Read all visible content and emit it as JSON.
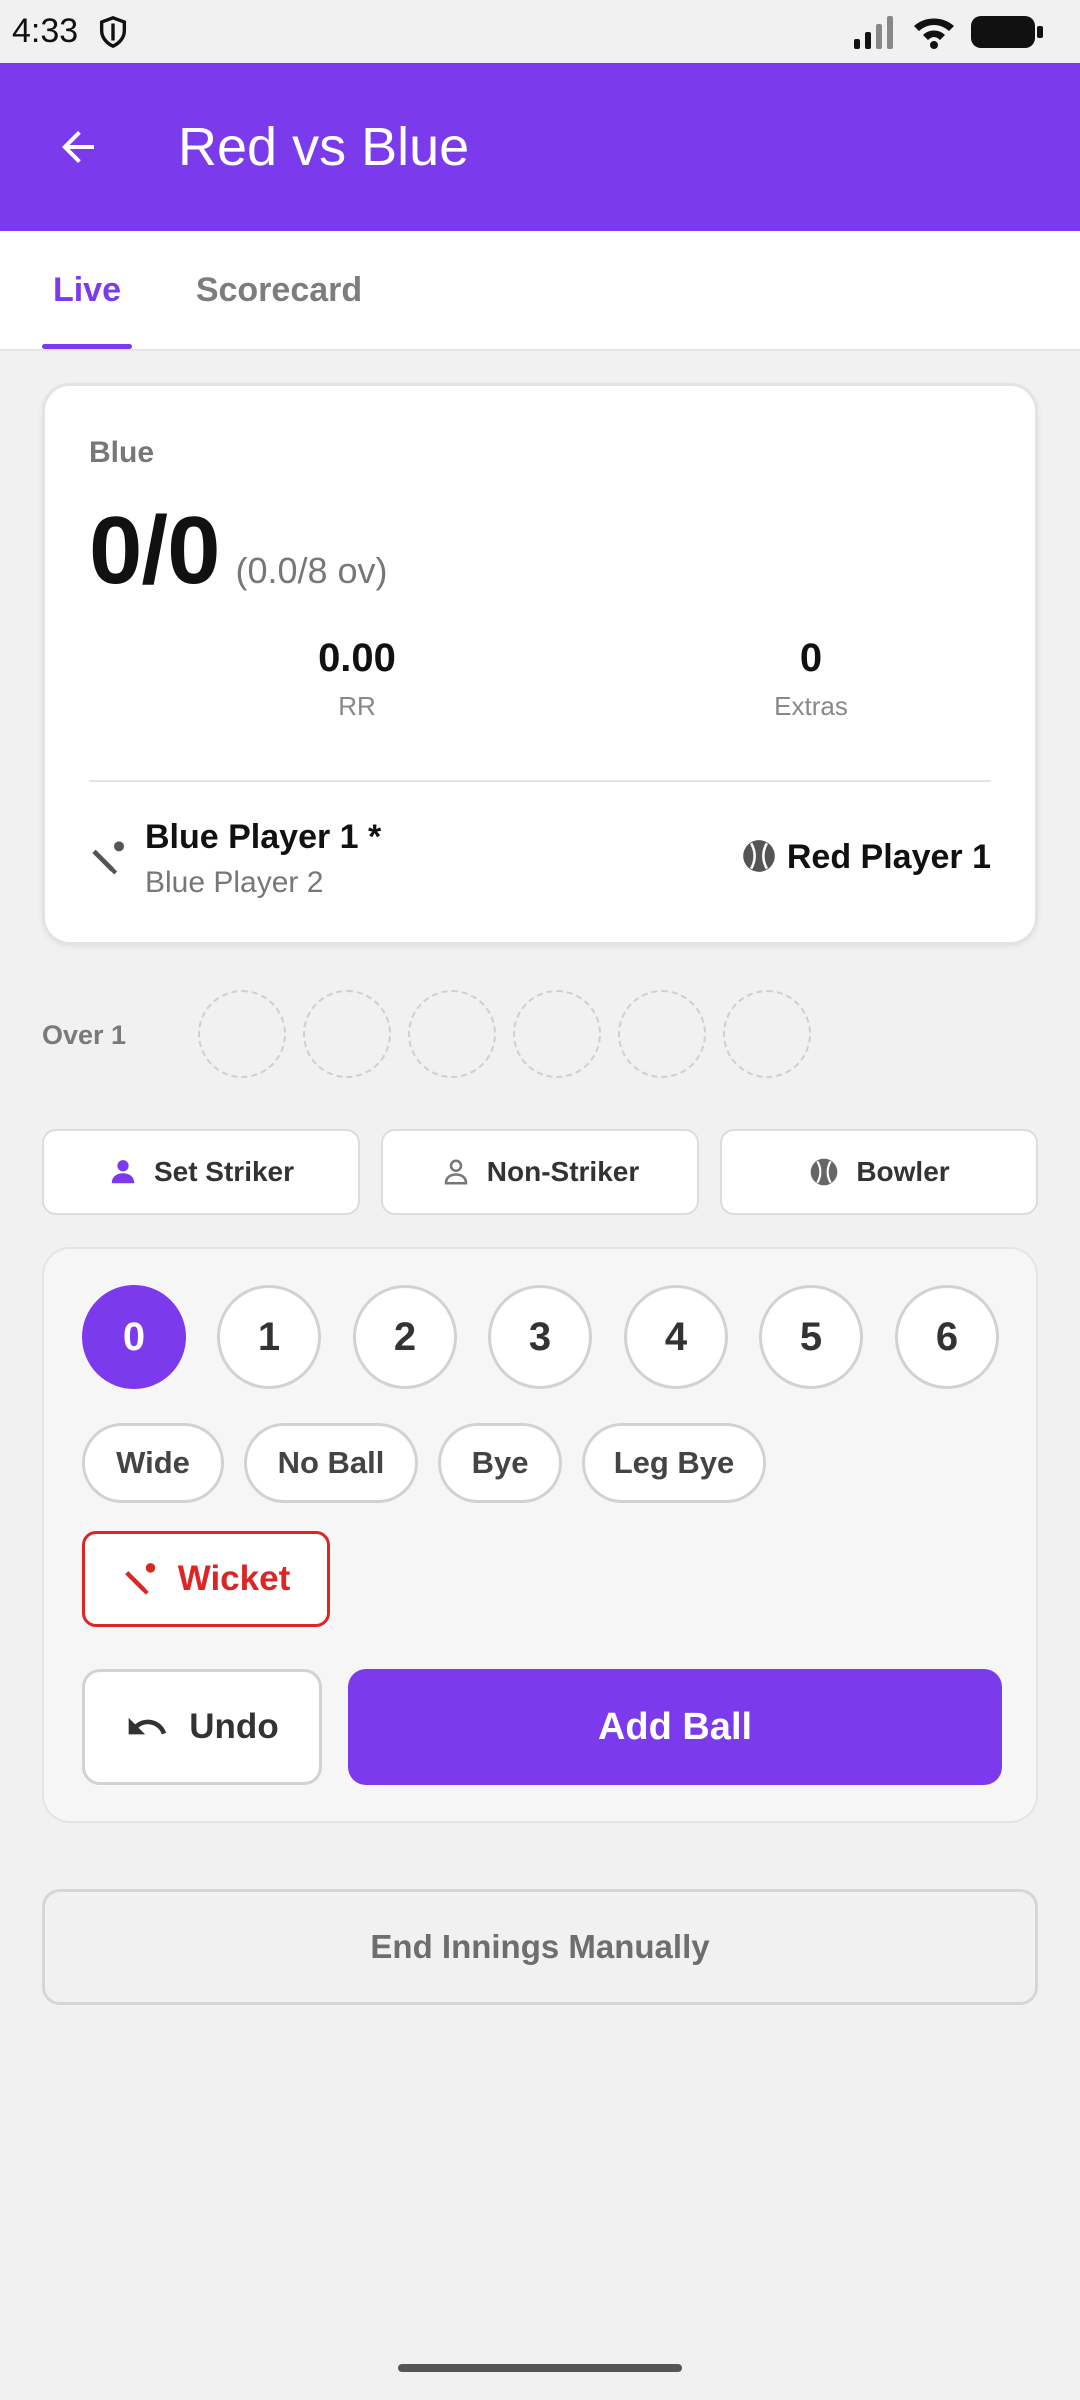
{
  "status_bar": {
    "time": "4:33"
  },
  "app_bar": {
    "title": "Red vs Blue"
  },
  "tabs": [
    {
      "label": "Live",
      "active": true
    },
    {
      "label": "Scorecard",
      "active": false
    }
  ],
  "score_card": {
    "team": "Blue",
    "score": "0/0",
    "overs": "(0.0/8 ov)",
    "run_rate": {
      "value": "0.00",
      "label": "RR"
    },
    "extras": {
      "value": "0",
      "label": "Extras"
    },
    "striker": "Blue Player 1 *",
    "non_striker": "Blue Player 2",
    "bowler": "Red Player 1"
  },
  "over": {
    "label": "Over 1",
    "ball_slots": 6
  },
  "role_buttons": {
    "set_striker": "Set Striker",
    "non_striker": "Non-Striker",
    "bowler": "Bowler"
  },
  "scoring": {
    "runs": [
      "0",
      "1",
      "2",
      "3",
      "4",
      "5",
      "6"
    ],
    "selected_run": "0",
    "extras": [
      "Wide",
      "No Ball",
      "Bye",
      "Leg Bye"
    ],
    "wicket_label": "Wicket",
    "undo_label": "Undo",
    "add_ball_label": "Add Ball"
  },
  "end_innings_label": "End Innings Manually",
  "colors": {
    "primary": "#7c3aed",
    "danger": "#dc2626",
    "background": "#f1f1f2"
  }
}
